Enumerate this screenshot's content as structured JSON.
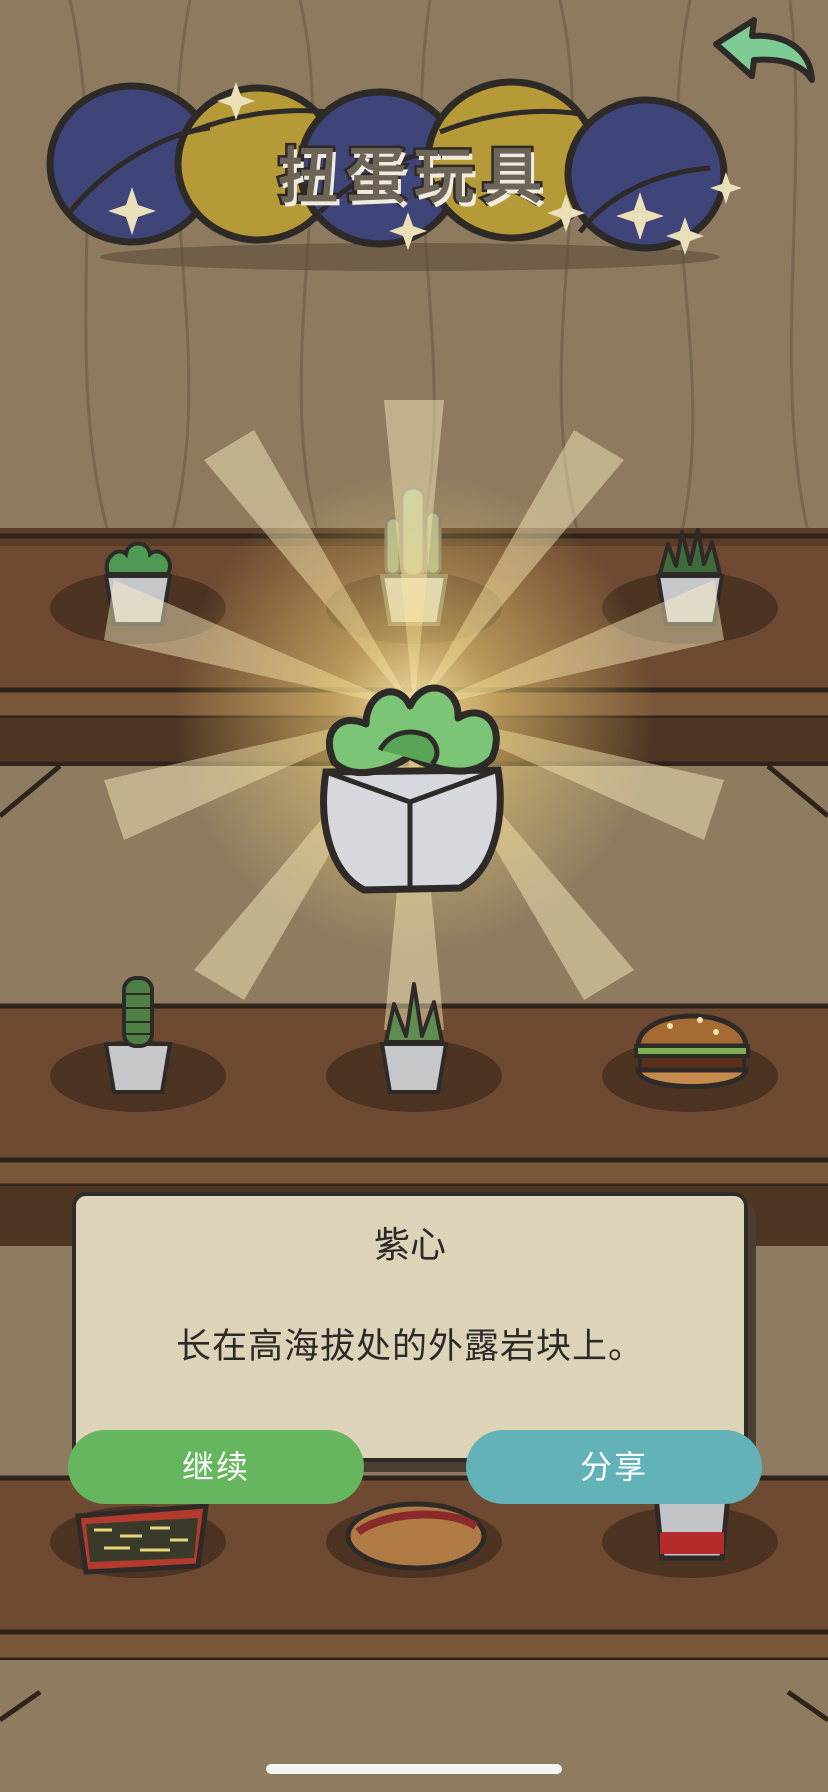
{
  "header": {
    "title": "扭蛋玩具",
    "back_icon": "back-arrow-icon"
  },
  "shelf_items": [
    {
      "name": "succulent-small",
      "icon": "succulent-icon"
    },
    {
      "name": "cactus",
      "icon": "cactus-icon"
    },
    {
      "name": "spiky-succulent",
      "icon": "succulent-icon"
    },
    {
      "name": "tall-succulent",
      "icon": "succulent-icon"
    },
    {
      "name": "aloe",
      "icon": "aloe-icon"
    },
    {
      "name": "burger",
      "icon": "burger-icon"
    },
    {
      "name": "fries",
      "icon": "fries-icon"
    },
    {
      "name": "hotdog",
      "icon": "hotdog-icon"
    },
    {
      "name": "cup",
      "icon": "cup-icon"
    }
  ],
  "featured": {
    "icon": "succulent-icon"
  },
  "dialog": {
    "title": "紫心",
    "description": "长在高海拔处的外露岩块上。"
  },
  "buttons": {
    "continue_label": "继续",
    "share_label": "分享"
  },
  "colors": {
    "continue_button": "#66b55f",
    "share_button": "#63b2b8",
    "dialog_background": "#ddd3b9",
    "capsule_blue": "#3f4479",
    "capsule_yellow": "#b69a38",
    "back_arrow": "#7ecb93"
  }
}
